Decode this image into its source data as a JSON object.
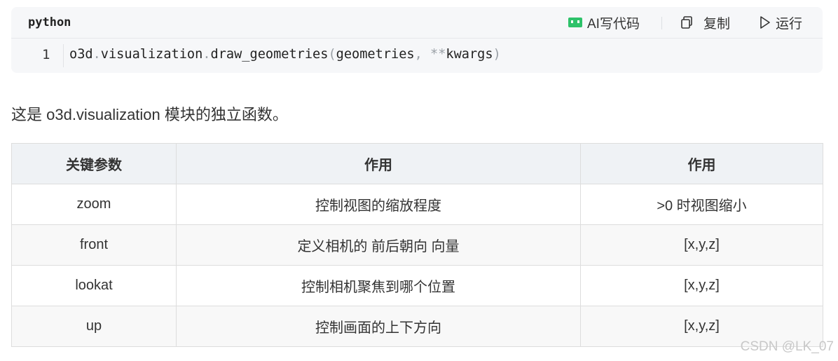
{
  "code_block": {
    "language": "python",
    "toolbar": {
      "ai_label": "AI写代码",
      "copy_label": "复制",
      "run_label": "运行"
    },
    "line_number": "1",
    "code": {
      "module": "o3d",
      "dot1": ".",
      "sub": "visualization",
      "dot2": ".",
      "func": "draw_geometries",
      "paren_open": "(",
      "arg1": "geometries",
      "comma": ",",
      "stars": "**",
      "arg2": "kwargs",
      "paren_close": ")"
    }
  },
  "description": "这是 o3d.visualization 模块的独立函数。",
  "table": {
    "headers": [
      "关键参数",
      "作用",
      "作用"
    ],
    "rows": [
      [
        "zoom",
        "控制视图的缩放程度",
        ">0 时视图缩小"
      ],
      [
        "front",
        "定义相机的 前后朝向 向量",
        "[x,y,z]"
      ],
      [
        "lookat",
        "控制相机聚焦到哪个位置",
        "[x,y,z]"
      ],
      [
        "up",
        "控制画面的上下方向",
        "[x,y,z]"
      ]
    ]
  },
  "watermark": "CSDN @LK_07",
  "colors": {
    "ai_icon": "#2ec26a",
    "code_bg": "#f6f7f9",
    "table_header_bg": "#eff2f5"
  }
}
